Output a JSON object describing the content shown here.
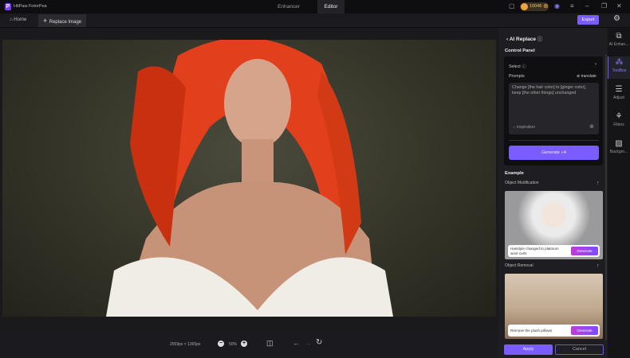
{
  "app": {
    "name": "HitPaw FotorPea",
    "modes": [
      "Enhancer",
      "Editor"
    ],
    "coins": "10046"
  },
  "toolbar": {
    "home": "Home",
    "replace": "Replace Image",
    "export": "Export"
  },
  "canvas": {
    "dimensions": "2559px × 1365px",
    "zoom": "50%"
  },
  "panel": {
    "title": "AI Replace",
    "control_panel": "Control Panel",
    "select": "Select",
    "prompts": "Prompts",
    "translate": "translate",
    "prompt_text": "Change [the hair color] to [ginger color], keep [the other things] unchanged",
    "inspiration": "inspiration",
    "generate": "Generate",
    "generate_cost": "4",
    "example": "Example",
    "examples": [
      {
        "title": "Object Modification",
        "caption": "Hairstyle changed to platinum wool curls",
        "button": "Generate"
      },
      {
        "title": "Object Removal",
        "caption": "Remove the plush pillows",
        "button": "Generate"
      }
    ],
    "apply": "Apply",
    "cancel": "Cancel"
  },
  "rail": [
    {
      "label": "AI Enhan..."
    },
    {
      "label": "ToolBox"
    },
    {
      "label": "Adjust"
    },
    {
      "label": "Filters"
    },
    {
      "label": "Backgro..."
    }
  ]
}
